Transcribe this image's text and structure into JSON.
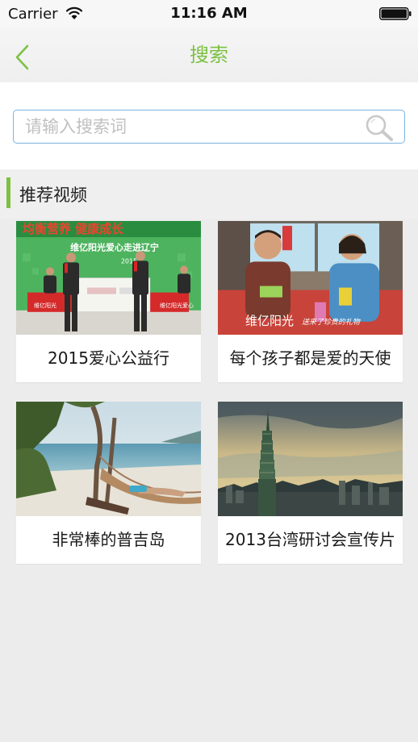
{
  "status_bar": {
    "carrier": "Carrier",
    "time": "11:16 AM"
  },
  "nav": {
    "title": "搜索",
    "back_icon": "chevron-left-icon"
  },
  "search": {
    "placeholder": "请输入搜索词",
    "value": "",
    "icon": "search-icon"
  },
  "section": {
    "title": "推荐视频"
  },
  "videos": [
    {
      "title": "2015爱心公益行",
      "thumb_banner": "维亿阳光爱心走进辽宁",
      "thumb_year": "2015",
      "thumb_top_text": "均衡营养  健康成长",
      "thumb_logo_text": "维亿阳光",
      "thumb_side_text": "维亿阳光爱心"
    },
    {
      "title": "每个孩子都是爱的天使",
      "thumb_caption": "维亿阳光",
      "thumb_caption_script": "送来了珍贵的礼物"
    },
    {
      "title": "非常棒的普吉岛"
    },
    {
      "title": "2013台湾研讨会宣传片"
    }
  ],
  "colors": {
    "accent": "#7cc142",
    "search_border": "#79b4e0"
  }
}
